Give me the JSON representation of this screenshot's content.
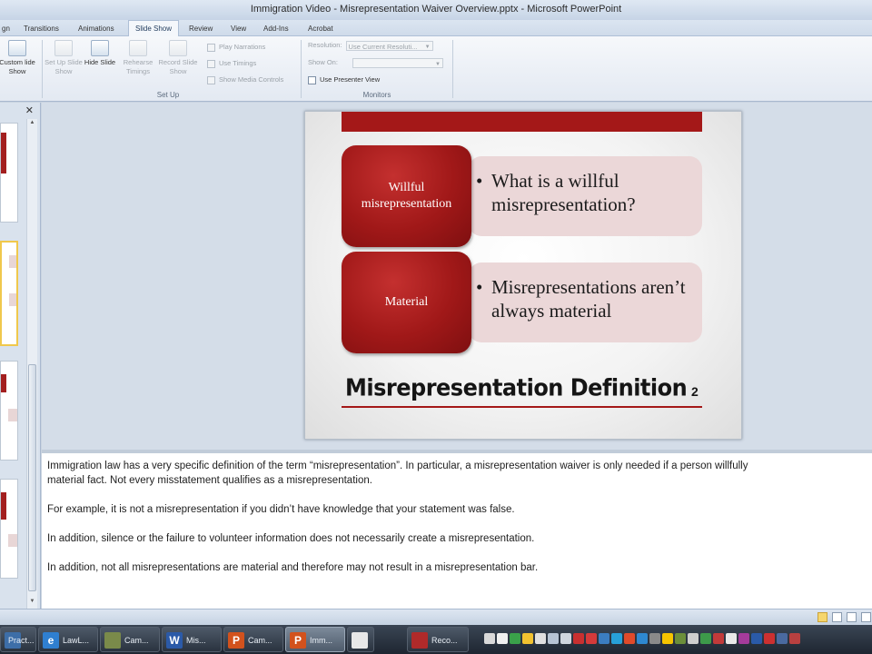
{
  "window": {
    "title": "Immigration Video - Misrepresentation Waiver Overview.pptx - Microsoft PowerPoint"
  },
  "ribbon": {
    "tabs": [
      "gn",
      "Transitions",
      "Animations",
      "Slide Show",
      "Review",
      "View",
      "Add-Ins",
      "Acrobat"
    ],
    "active_tab": "Slide Show",
    "buttons": {
      "custom_slide_show": "Custom lide Show",
      "set_up_slide_show": "Set Up Slide Show",
      "hide_slide": "Hide Slide",
      "rehearse_timings": "Rehearse Timings",
      "record_slide_show": "Record Slide Show"
    },
    "checks": {
      "play_narrations": "Play Narrations",
      "use_timings": "Use Timings",
      "show_media_controls": "Show Media Controls",
      "use_presenter_view": "Use Presenter View"
    },
    "monitors": {
      "resolution_label": "Resolution:",
      "resolution_value": "Use Current Resoluti...",
      "show_on_label": "Show On:"
    },
    "groups": {
      "setup": "Set Up",
      "monitors": "Monitors"
    }
  },
  "slide": {
    "items": [
      {
        "box": "Willful misrepresentation",
        "bullet": "What is a willful misrepresentation?"
      },
      {
        "box": "Material",
        "bullet": "Misrepresentations aren’t always material"
      }
    ],
    "bullet_char": "•",
    "heading": "Misrepresentation Definition",
    "page_number": "2"
  },
  "notes": {
    "p1_line1": "Immigration law has a very specific definition of the term “misrepresentation”.  In particular, a misrepresentation waiver is only needed if a person willfully",
    "p1_line2": "material fact. Not every misstatement qualifies as a misrepresentation.",
    "p2": "For example, it is not a misrepresentation if you didn’t have knowledge that your statement was false.",
    "p3": "In addition, silence or the failure to volunteer information does not necessarily create a misrepresentation.",
    "p4": "In addition, not all misrepresentations are material and therefore may not result in a misrepresentation bar."
  },
  "taskbar": {
    "items": [
      {
        "label": "Pract...",
        "icon": "app-icon",
        "color": "#3d6ea8",
        "glyph": ""
      },
      {
        "label": "LawL...",
        "icon": "internet-explorer-icon",
        "color": "#2f7fd0",
        "glyph": "e"
      },
      {
        "label": "Cam...",
        "icon": "camtasia-icon",
        "color": "#7a8a4a",
        "glyph": ""
      },
      {
        "label": "Mis...",
        "icon": "word-icon",
        "color": "#2b5aa8",
        "glyph": "W"
      },
      {
        "label": "Cam...",
        "icon": "powerpoint-icon",
        "color": "#d2521d",
        "glyph": "P"
      },
      {
        "label": "Imm...",
        "icon": "powerpoint-icon",
        "color": "#d2521d",
        "glyph": "P"
      },
      {
        "label": "",
        "icon": "document-icon",
        "color": "#e8e8e8",
        "glyph": ""
      },
      {
        "label": "Reco...",
        "icon": "recorder-icon",
        "color": "#b02a2a",
        "glyph": ""
      }
    ]
  },
  "colors": {
    "accent_red": "#a41818",
    "pill_pink": "#ebd7d8"
  }
}
